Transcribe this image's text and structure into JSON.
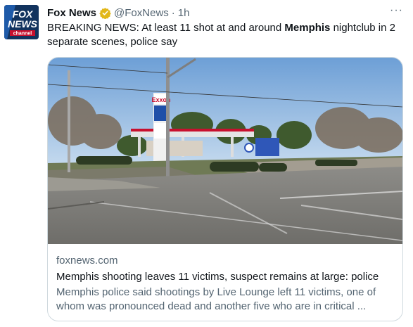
{
  "account": {
    "name": "Fox News",
    "handle": "@FoxNews",
    "separator": "·",
    "time": "1h",
    "avatar_logo_line1": "FOX",
    "avatar_logo_line2": "NEWS",
    "avatar_logo_line3": "channel"
  },
  "menu_label": "···",
  "tweet": {
    "text_before": "BREAKING NEWS: At least 11 shot at and around ",
    "text_bold": "Memphis",
    "text_after": " nightclub in 2 separate scenes, police say"
  },
  "card": {
    "domain": "foxnews.com",
    "title": "Memphis shooting leaves 11 victims, suspect remains at large: police",
    "description": "Memphis police said shootings by Live Lounge left 11 victims, one of whom was pronounced dead and another five who are in critical ...",
    "image_sign_text": "Exxon"
  },
  "colors": {
    "brand_navy": "#12335e",
    "verified_gold": "#e2b719",
    "secondary_text": "#536471",
    "border": "#cfd9de"
  },
  "icons": {
    "verified": "verified-badge-icon",
    "more": "more-options-icon"
  }
}
